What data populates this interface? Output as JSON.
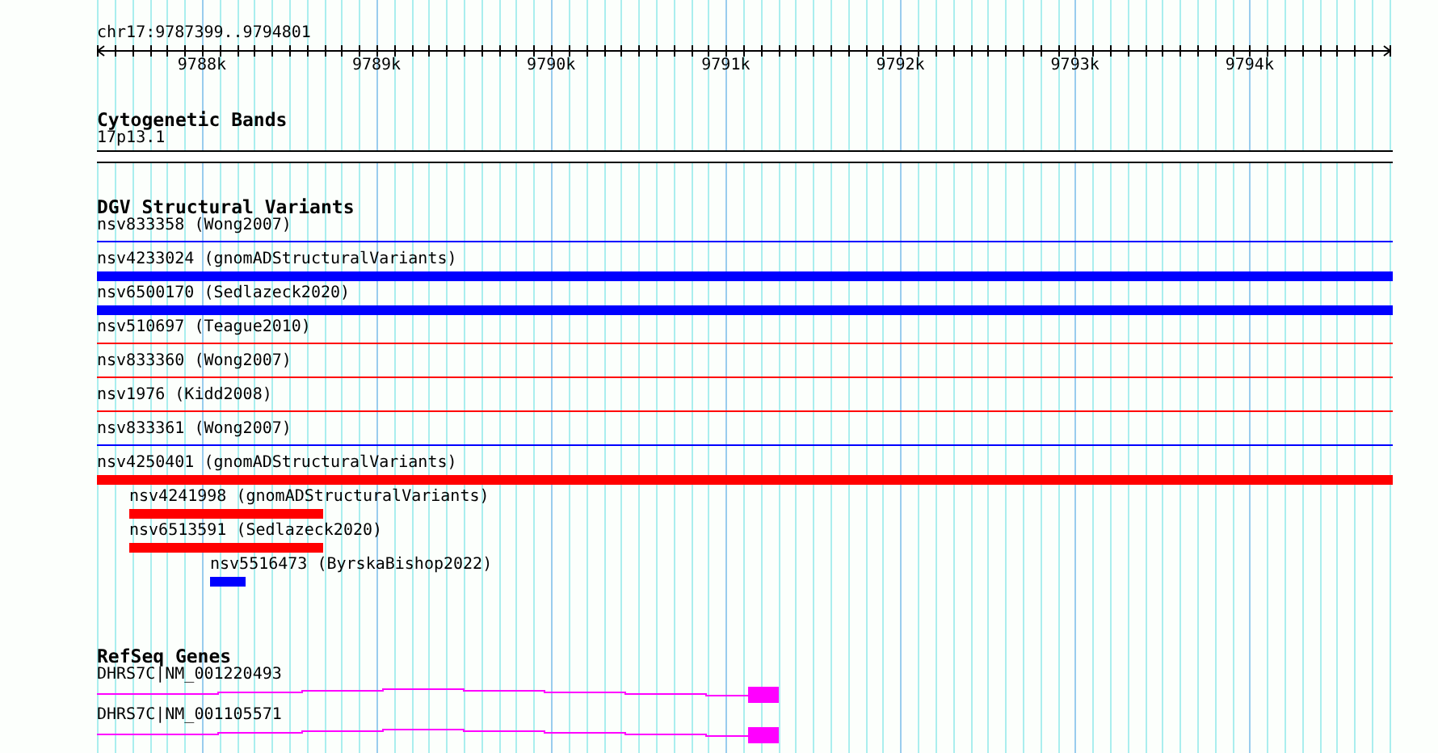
{
  "ruler": {
    "location": "chr17:9787399..9794801",
    "ticks": [
      "9788k",
      "9789k",
      "9790k",
      "9791k",
      "9792k",
      "9793k",
      "9794k"
    ]
  },
  "tracks": [
    {
      "kind": "cytoband",
      "title": "Cytogenetic Bands",
      "features": [
        {
          "label": "17p13.1"
        }
      ]
    },
    {
      "kind": "variants",
      "title": "DGV Structural Variants",
      "features": [
        {
          "label": "nsv833358 (Wong2007)",
          "kind": "thin",
          "color": "#0000ff"
        },
        {
          "label": "nsv4233024 (gnomADStructuralVariants)",
          "kind": "thick",
          "color": "#0000ff"
        },
        {
          "label": "nsv6500170 (Sedlazeck2020)",
          "kind": "thick",
          "color": "#0000ff"
        },
        {
          "label": "nsv510697 (Teague2010)",
          "kind": "thin",
          "color": "#ff0000"
        },
        {
          "label": "nsv833360 (Wong2007)",
          "kind": "thin",
          "color": "#ff0000"
        },
        {
          "label": "nsv1976 (Kidd2008)",
          "kind": "thin",
          "color": "#ff0000"
        },
        {
          "label": "nsv833361 (Wong2007)",
          "kind": "thin",
          "color": "#0000ff"
        },
        {
          "label": "nsv4250401 (gnomADStructuralVariants)",
          "kind": "thick",
          "color": "#ff0000"
        },
        {
          "label": "nsv4241998 (gnomADStructuralVariants)",
          "kind": "thick",
          "color": "#ff0000"
        },
        {
          "label": "nsv6513591 (Sedlazeck2020)",
          "kind": "thick",
          "color": "#ff0000"
        },
        {
          "label": "nsv5516473 (ByrskaBishop2022)",
          "kind": "thick",
          "color": "#0000ff"
        }
      ]
    },
    {
      "kind": "genes",
      "title": "RefSeq Genes",
      "features": [
        {
          "label": "DHRS7C|NM_001220493"
        },
        {
          "label": "DHRS7C|NM_001105571"
        }
      ]
    }
  ]
}
